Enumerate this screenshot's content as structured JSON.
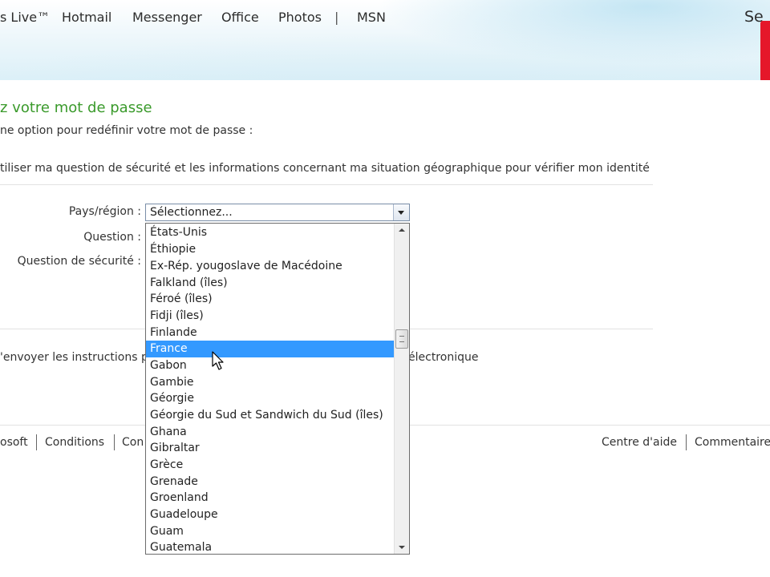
{
  "header": {
    "brand": "s Live™",
    "nav": [
      "Hotmail",
      "Messenger",
      "Office",
      "Photos",
      "|",
      "MSN"
    ],
    "right_text": "Se"
  },
  "page": {
    "title": "z votre mot de passe",
    "intro": "ne option pour redéfinir votre mot de passe :",
    "option_security": "tiliser ma question de sécurité et les informations concernant ma situation géographique pour vérifier mon identité",
    "option_email_start": "'envoyer les instructions p",
    "option_email_end": "électronique"
  },
  "form": {
    "country_label": "Pays/région :",
    "question_label": "Question :",
    "security_question_label": "Question de sécurité :",
    "country_select_value": "Sélectionnez...",
    "country_options": [
      "États-Unis",
      "Éthiopie",
      "Ex-Rép. yougoslave de Macédoine",
      "Falkland (îles)",
      "Féroé (îles)",
      "Fidji (îles)",
      "Finlande",
      "France",
      "Gabon",
      "Gambie",
      "Géorgie",
      "Géorgie du Sud et Sandwich du Sud (îles)",
      "Ghana",
      "Gibraltar",
      "Grèce",
      "Grenade",
      "Groenland",
      "Guadeloupe",
      "Guam",
      "Guatemala"
    ],
    "highlighted_option": "France"
  },
  "footer": {
    "left": [
      "osoft",
      "Conditions",
      "Con"
    ],
    "right": [
      "Centre d'aide",
      "Commentaire"
    ]
  },
  "colors": {
    "title_green": "#3a9a2b",
    "selection_blue": "#3399ff",
    "brand_red": "#e5172a"
  }
}
